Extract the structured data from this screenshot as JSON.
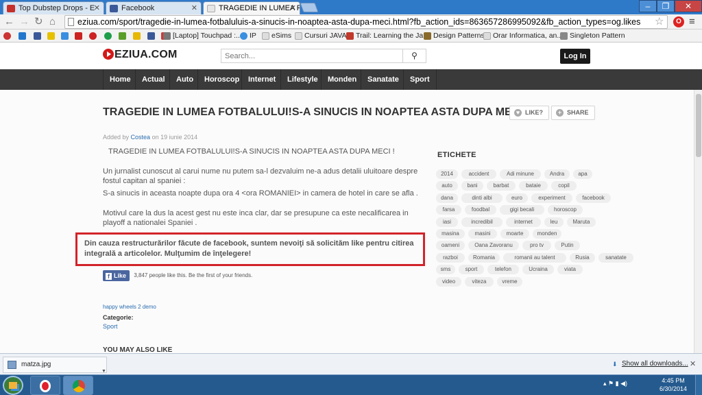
{
  "browser": {
    "tabs": [
      {
        "title": "Top Dubstep Drops - E",
        "active": false,
        "favicon_color": "#c4302b"
      },
      {
        "title": "Facebook",
        "active": false,
        "favicon_color": "#3b5998"
      },
      {
        "title": "TRAGEDIE IN LUMEA FOTB",
        "active": true,
        "favicon_color": "#bbbbbb"
      }
    ],
    "url": "eziua.com/sport/tragedie-in-lumea-fotbaluluis-a-sinucis-in-noaptea-asta-dupa-meci.html?fb_action_ids=863657286995092&fb_action_types=og.likes",
    "bookmarks": [
      {
        "label": "[Laptop] Touchpad :...",
        "color": "#777777"
      },
      {
        "label": "IP",
        "color": "#3a8ee0"
      },
      {
        "label": "eSims",
        "color": "#bbbbbb"
      },
      {
        "label": "Cursuri JAVA",
        "color": "#bbbbbb"
      },
      {
        "label": "Trail: Learning the Ja...",
        "color": "#c0392b"
      },
      {
        "label": "Design Patterns",
        "color": "#8a6a2a"
      },
      {
        "label": "Orar Informatica, an...",
        "color": "#bbbbbb"
      },
      {
        "label": "Singleton Pattern",
        "color": "#888888"
      }
    ]
  },
  "site": {
    "logo": "EZIUA.COM",
    "search_placeholder": "Search...",
    "login_label": "Log In",
    "nav": [
      "Home",
      "Actual",
      "Auto",
      "Horoscop",
      "Internet",
      "Lifestyle",
      "Monden",
      "Sanatate",
      "Sport"
    ]
  },
  "article": {
    "title": "TRAGEDIE IN LUMEA FOTBALULUI!S-A SINUCIS IN NOAPTEA ASTA DUPA MECI !",
    "like_label": "LIKE?",
    "share_label": "SHARE",
    "added_by": "Added by",
    "author": "Costea",
    "date": "on 19 iunie 2014",
    "p1": "TRAGEDIE IN LUMEA FOTBALULUI!S-A SINUCIS IN NOAPTEA ASTA DUPA MECI !",
    "p2": "Un jurnalist cunoscut al carui nume nu putem sa-l dezvaluim ne-a adus detalii uluitoare  despre fostul capitan al spaniei :",
    "p3": "S-a sinucis in aceasta noapte dupa ora 4 <ora ROMANIEI> in camera de hotel in care se afla .",
    "p4": "Motivul care la dus la acest gest nu este inca clar, dar se presupune ca este necalificarea in playoff a nationalei Spaniei .",
    "notice": "Din cauza restructurărilor făcute de facebook, suntem nevoiţi să solicităm like pentru citirea integrală a articolelor. Mulţumim de înţelegere!",
    "fb_like_label": "Like",
    "fb_like_text": "3,847 people like this. Be the first of your friends.",
    "happy_link": "happy wheels 2 demo",
    "category_label": "Categorie:",
    "category_value": "Sport",
    "also_like": "YOU MAY ALSO LIKE"
  },
  "sidebar": {
    "heading": "ETICHETE",
    "tags": [
      "2014",
      "accident",
      "Adi minune",
      "Andra",
      "apa",
      "auto",
      "bani",
      "barbat",
      "bataie",
      "copil",
      "dana",
      "dinti albi",
      "euro",
      "experiment",
      "facebook",
      "farsa",
      "foodbal",
      "gigi becali",
      "horoscop",
      "iasi",
      "incredibil",
      "internet",
      "leu",
      "Maruta",
      "masina",
      "masini",
      "moarte",
      "monden",
      "oameni",
      "Oana Zavoranu",
      "pro tv",
      "Putin",
      "razboi",
      "Romania",
      "romanii au talent",
      "Rusia",
      "sanatate",
      "sms",
      "sport",
      "telefon",
      "Ucraina",
      "viata",
      "video",
      "viteza",
      "vreme"
    ]
  },
  "downloads": {
    "file": "matza.jpg",
    "show_all": "Show all downloads..."
  },
  "taskbar": {
    "time": "4:45 PM",
    "date": "6/30/2014"
  }
}
